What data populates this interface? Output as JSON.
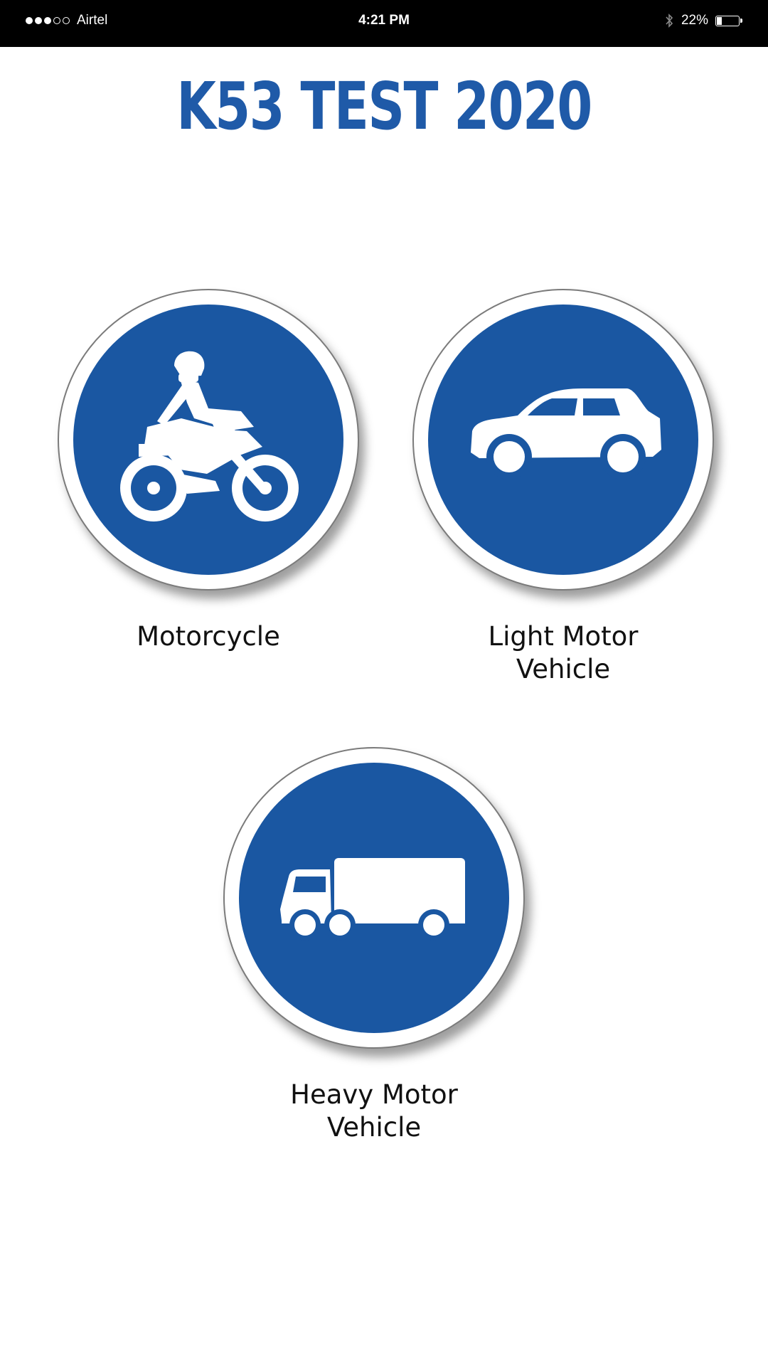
{
  "status_bar": {
    "carrier": "Airtel",
    "time": "4:21 PM",
    "battery_percent_label": "22%",
    "battery_level": 0.22,
    "signal_bars_filled": 3,
    "signal_bars_total": 5
  },
  "header": {
    "title": "K53 TEST 2020",
    "title_color": "#1f5aa8"
  },
  "categories": [
    {
      "icon": "motorcycle-icon",
      "label_lines": [
        "Motorcycle"
      ]
    },
    {
      "icon": "car-icon",
      "label_lines": [
        "Light Motor",
        "Vehicle"
      ]
    },
    {
      "icon": "truck-icon",
      "label_lines": [
        "Heavy Motor",
        "Vehicle"
      ]
    }
  ],
  "colors": {
    "sign_blue": "#1a57a2",
    "status_bar_bg": "#000000",
    "page_bg": "#ffffff"
  }
}
